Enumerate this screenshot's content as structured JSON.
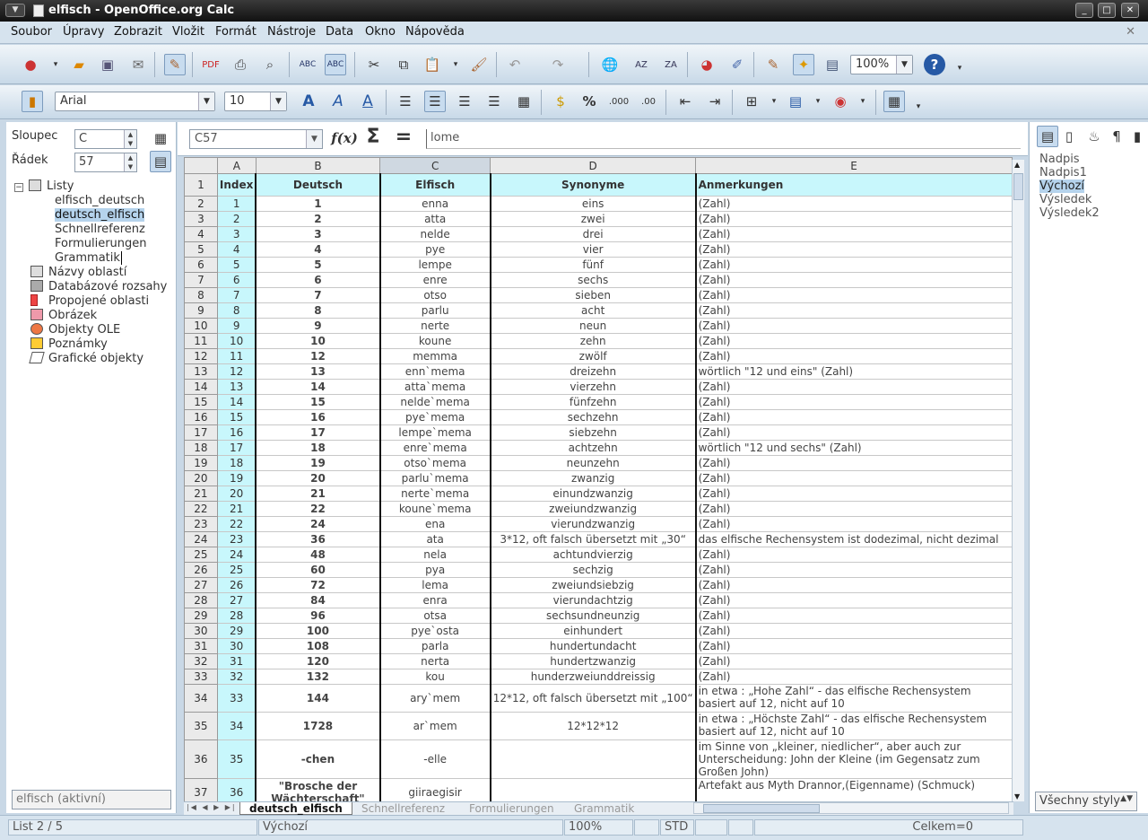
{
  "window": {
    "title": "elfisch - OpenOffice.org Calc"
  },
  "menu": [
    "Soubor",
    "Úpravy",
    "Zobrazit",
    "Vložit",
    "Formát",
    "Nástroje",
    "Data",
    "Okno",
    "Nápověda"
  ],
  "toolbar": {
    "zoom": "100%"
  },
  "format": {
    "font": "Arial",
    "size": "10"
  },
  "navigator": {
    "column_label": "Sloupec",
    "column_value": "C",
    "row_label": "Řádek",
    "row_value": "57",
    "root": "Listy",
    "sheets": [
      "elfisch_deutsch",
      "deutsch_elfisch",
      "Schnellreferenz",
      "Formulierungen",
      "Grammatik"
    ],
    "categories": [
      "Názvy oblastí",
      "Databázové rozsahy",
      "Propojené oblasti",
      "Obrázek",
      "Objekty OLE",
      "Poznámky",
      "Grafické objekty"
    ],
    "document": "elfisch (aktivní)"
  },
  "styles": {
    "items": [
      "Nadpis",
      "Nadpis1",
      "Výchozí",
      "Výsledek",
      "Výsledek2"
    ],
    "selected": "Výchozí",
    "filter": "Všechny styly"
  },
  "formula": {
    "cell_ref": "C57",
    "content": "lome"
  },
  "sheet": {
    "columns": [
      "A",
      "B",
      "C",
      "D",
      "E"
    ],
    "header_row": {
      "row": "1",
      "a": "Index",
      "b": "Deutsch",
      "c": "Elfisch",
      "d": "Synonyme",
      "e": "Anmerkungen"
    },
    "rows": [
      {
        "r": "2",
        "a": "1",
        "b": "1",
        "c": "enna",
        "d": "eins",
        "e": "(Zahl)"
      },
      {
        "r": "3",
        "a": "2",
        "b": "2",
        "c": "atta",
        "d": "zwei",
        "e": "(Zahl)"
      },
      {
        "r": "4",
        "a": "3",
        "b": "3",
        "c": "nelde",
        "d": "drei",
        "e": "(Zahl)"
      },
      {
        "r": "5",
        "a": "4",
        "b": "4",
        "c": "pye",
        "d": "vier",
        "e": "(Zahl)"
      },
      {
        "r": "6",
        "a": "5",
        "b": "5",
        "c": "lempe",
        "d": "fünf",
        "e": "(Zahl)"
      },
      {
        "r": "7",
        "a": "6",
        "b": "6",
        "c": "enre",
        "d": "sechs",
        "e": "(Zahl)"
      },
      {
        "r": "8",
        "a": "7",
        "b": "7",
        "c": "otso",
        "d": "sieben",
        "e": "(Zahl)"
      },
      {
        "r": "9",
        "a": "8",
        "b": "8",
        "c": "parlu",
        "d": "acht",
        "e": "(Zahl)"
      },
      {
        "r": "10",
        "a": "9",
        "b": "9",
        "c": "nerte",
        "d": "neun",
        "e": "(Zahl)"
      },
      {
        "r": "11",
        "a": "10",
        "b": "10",
        "c": "koune",
        "d": "zehn",
        "e": "(Zahl)"
      },
      {
        "r": "12",
        "a": "11",
        "b": "12",
        "c": "memma",
        "d": "zwölf",
        "e": "(Zahl)"
      },
      {
        "r": "13",
        "a": "12",
        "b": "13",
        "c": "enn`mema",
        "d": "dreizehn",
        "e": "wörtlich \"12 und eins\" (Zahl)"
      },
      {
        "r": "14",
        "a": "13",
        "b": "14",
        "c": "atta`mema",
        "d": "vierzehn",
        "e": "(Zahl)"
      },
      {
        "r": "15",
        "a": "14",
        "b": "15",
        "c": "nelde`mema",
        "d": "fünfzehn",
        "e": "(Zahl)"
      },
      {
        "r": "16",
        "a": "15",
        "b": "16",
        "c": "pye`mema",
        "d": "sechzehn",
        "e": "(Zahl)"
      },
      {
        "r": "17",
        "a": "16",
        "b": "17",
        "c": "lempe`mema",
        "d": "siebzehn",
        "e": "(Zahl)"
      },
      {
        "r": "18",
        "a": "17",
        "b": "18",
        "c": "enre`mema",
        "d": "achtzehn",
        "e": "wörtlich \"12 und sechs\" (Zahl)"
      },
      {
        "r": "19",
        "a": "18",
        "b": "19",
        "c": "otso`mema",
        "d": "neunzehn",
        "e": "(Zahl)"
      },
      {
        "r": "20",
        "a": "19",
        "b": "20",
        "c": "parlu`mema",
        "d": "zwanzig",
        "e": "(Zahl)"
      },
      {
        "r": "21",
        "a": "20",
        "b": "21",
        "c": "nerte`mema",
        "d": "einundzwanzig",
        "e": "(Zahl)"
      },
      {
        "r": "22",
        "a": "21",
        "b": "22",
        "c": "koune`mema",
        "d": "zweiundzwanzig",
        "e": "(Zahl)"
      },
      {
        "r": "23",
        "a": "22",
        "b": "24",
        "c": "ena",
        "d": "vierundzwanzig",
        "e": "(Zahl)"
      },
      {
        "r": "24",
        "a": "23",
        "b": "36",
        "c": "ata",
        "d": "3*12, oft falsch übersetzt mit „30“",
        "e": "das elfische Rechensystem ist dodezimal, nicht dezimal"
      },
      {
        "r": "25",
        "a": "24",
        "b": "48",
        "c": "nela",
        "d": "achtundvierzig",
        "e": "(Zahl)"
      },
      {
        "r": "26",
        "a": "25",
        "b": "60",
        "c": "pya",
        "d": "sechzig",
        "e": "(Zahl)"
      },
      {
        "r": "27",
        "a": "26",
        "b": "72",
        "c": "lema",
        "d": "zweiundsiebzig",
        "e": "(Zahl)"
      },
      {
        "r": "28",
        "a": "27",
        "b": "84",
        "c": "enra",
        "d": "vierundachtzig",
        "e": "(Zahl)"
      },
      {
        "r": "29",
        "a": "28",
        "b": "96",
        "c": "otsa",
        "d": "sechsundneunzig",
        "e": "(Zahl)"
      },
      {
        "r": "30",
        "a": "29",
        "b": "100",
        "c": "pye`osta",
        "d": "einhundert",
        "e": "(Zahl)"
      },
      {
        "r": "31",
        "a": "30",
        "b": "108",
        "c": "parla",
        "d": "hundertundacht",
        "e": "(Zahl)"
      },
      {
        "r": "32",
        "a": "31",
        "b": "120",
        "c": "nerta",
        "d": "hundertzwanzig",
        "e": "(Zahl)"
      },
      {
        "r": "33",
        "a": "32",
        "b": "132",
        "c": "kou",
        "d": "hunderzweiunddreissig",
        "e": "(Zahl)"
      }
    ],
    "tall_rows": [
      {
        "r": "34",
        "a": "33",
        "b": "144",
        "c": "ary`mem",
        "d": "12*12, oft falsch übersetzt mit „100“",
        "e": "in etwa : „Hohe Zahl“ - das elfische Rechensystem basiert auf 12, nicht auf 10"
      },
      {
        "r": "35",
        "a": "34",
        "b": "1728",
        "c": "ar`mem",
        "d": "12*12*12",
        "e": "in etwa : „Höchste Zahl“ - das elfische Rechensystem basiert auf 12, nicht auf 10"
      },
      {
        "r": "36",
        "a": "35",
        "b": "-chen",
        "c": "-elle",
        "d": "",
        "e": "im Sinne von „kleiner, niedlicher“, aber auch zur Unterscheidung: John der Kleine (im Gegensatz zum Großen John)"
      },
      {
        "r": "37",
        "a": "36",
        "b": "\"Brosche der Wächterschaft\"",
        "c": "giiraegisir",
        "d": "",
        "e": "Artefakt aus Myth Drannor,(Eigenname) (Schmuck)"
      }
    ]
  },
  "tabs": [
    "deutsch_elfisch",
    "Schnellreferenz",
    "Formulierungen",
    "Grammatik"
  ],
  "status": {
    "sheet": "List 2 / 5",
    "style": "Výchozí",
    "zoom": "100%",
    "mode": "STD",
    "sum": "Celkem=0"
  }
}
